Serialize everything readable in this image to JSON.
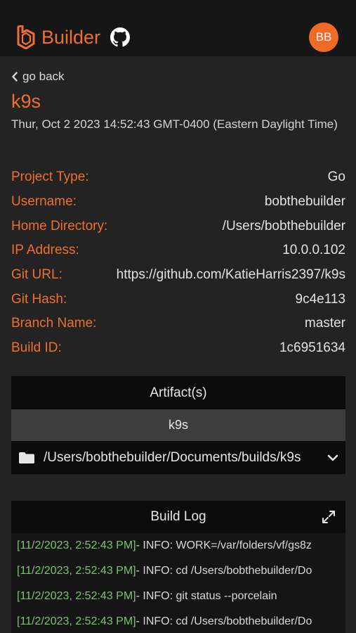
{
  "header": {
    "brand": "Builder",
    "avatar_initials": "BB",
    "accent_color": "#ef6f2e"
  },
  "nav": {
    "back_label": "go back"
  },
  "build": {
    "title": "k9s",
    "date": "Thur, Oct 2 2023 14:52:43 GMT-0400 (Eastern Daylight Time)",
    "fields": [
      {
        "label": "Project Type:",
        "value": "Go"
      },
      {
        "label": "Username:",
        "value": "bobthebuilder"
      },
      {
        "label": "Home Directory:",
        "value": "/Users/bobthebuilder"
      },
      {
        "label": "IP Address:",
        "value": "10.0.0.102"
      },
      {
        "label": "Git URL:",
        "value": "https://github.com/KatieHarris2397/k9s"
      },
      {
        "label": "Git Hash:",
        "value": "9c4e113"
      },
      {
        "label": "Branch Name:",
        "value": "master"
      },
      {
        "label": "Build ID:",
        "value": "1c6951634"
      }
    ]
  },
  "artifacts": {
    "header": "Artifact(s)",
    "name": "k9s",
    "path": "/Users/bobthebuilder/Documents/builds/k9s"
  },
  "build_log": {
    "header": "Build Log",
    "lines": [
      {
        "timestamp": "[11/2/2023, 2:52:43 PM]",
        "message": " - INFO: WORK=/var/folders/vf/gs8z"
      },
      {
        "timestamp": "[11/2/2023, 2:52:43 PM]",
        "message": " - INFO: cd /Users/bobthebuilder/Do"
      },
      {
        "timestamp": "[11/2/2023, 2:52:43 PM]",
        "message": " - INFO: git status --porcelain"
      },
      {
        "timestamp": "[11/2/2023, 2:52:43 PM]",
        "message": " - INFO: cd /Users/bobthebuilder/Do"
      }
    ]
  }
}
